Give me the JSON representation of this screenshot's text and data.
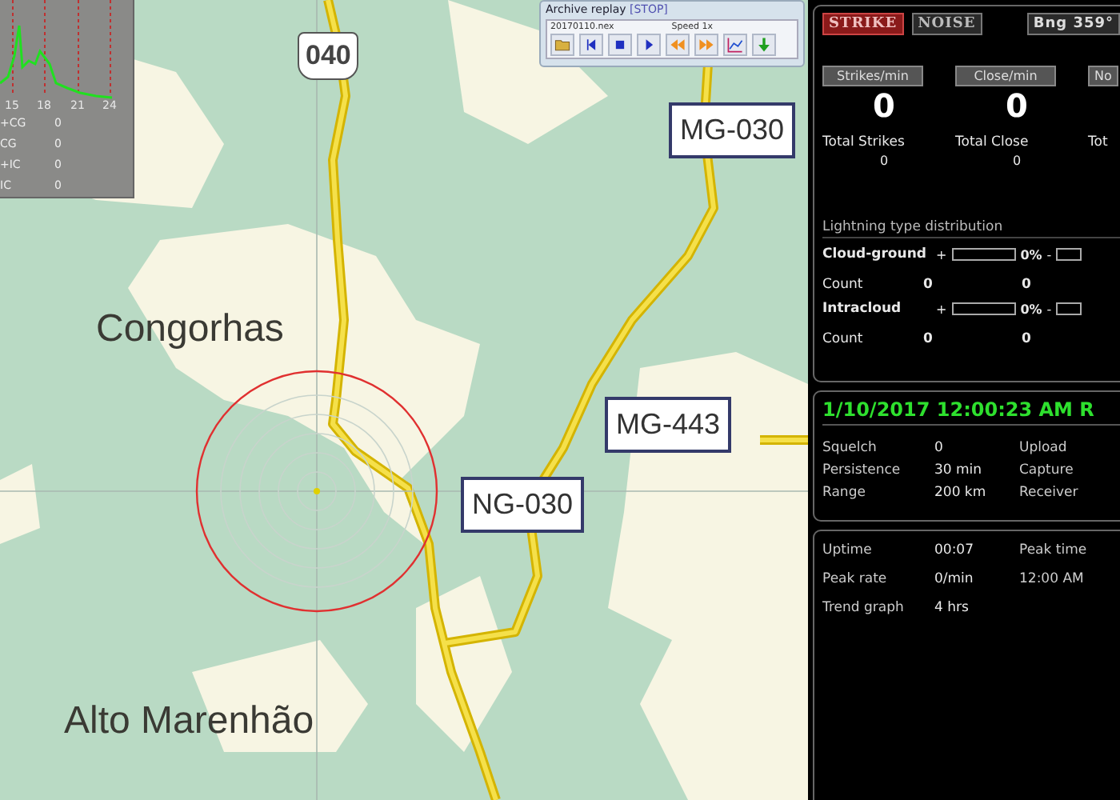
{
  "mini_chart": {
    "x_labels": [
      "15",
      "18",
      "21",
      "24"
    ],
    "rows": [
      {
        "label": "+CG",
        "value": "0"
      },
      {
        "label": "CG",
        "value": "0"
      },
      {
        "label": "+IC",
        "value": "0"
      },
      {
        "label": "IC",
        "value": "0"
      }
    ]
  },
  "replay_window": {
    "title": "Archive replay",
    "state": "[STOP]",
    "file": "20170110.nex",
    "speed": "Speed 1x"
  },
  "map": {
    "labels": [
      {
        "kind": "shield",
        "text": "040"
      },
      {
        "kind": "route",
        "text": "MG-030"
      },
      {
        "kind": "town",
        "text": "Congorhas"
      },
      {
        "kind": "route",
        "text": "MG-443"
      },
      {
        "kind": "route",
        "text": "NG-030"
      },
      {
        "kind": "town",
        "text": "Alto Marenhão"
      }
    ]
  },
  "status": {
    "modes": [
      {
        "label": "STRIKE",
        "selected": true
      },
      {
        "label": "NOISE",
        "selected": false
      }
    ],
    "bearing": "Bng 359°"
  },
  "rates": [
    {
      "button": "Strikes/min",
      "value": "0",
      "total_label": "Total Strikes",
      "total": "0"
    },
    {
      "button": "Close/min",
      "value": "0",
      "total_label": "Total Close",
      "total": "0"
    },
    {
      "button": "No",
      "total_label": "Tot"
    }
  ],
  "distribution": {
    "title": "Lightning type distribution",
    "types": [
      {
        "name": "Cloud-ground",
        "plus": {
          "sign": "+",
          "level": 0
        },
        "percent": "0%",
        "minus": {
          "sign": "-",
          "level": 0
        },
        "count_label": "Count",
        "counts": [
          "0",
          "0"
        ]
      },
      {
        "name": "Intracloud",
        "plus": {
          "sign": "+",
          "level": 0
        },
        "percent": "0%",
        "minus": {
          "sign": "-",
          "level": 0
        },
        "count_label": "Count",
        "counts": [
          "0",
          "0"
        ]
      }
    ]
  },
  "clock": {
    "datetime": "1/10/2017 12:00:23 AM R",
    "rows": [
      [
        "Squelch",
        "0",
        "Upload"
      ],
      [
        "Persistence",
        "30 min",
        "Capture"
      ],
      [
        "Range",
        "200 km",
        "Receiver"
      ]
    ]
  },
  "stats": {
    "rows": [
      [
        "Uptime",
        "00:07",
        "Peak time"
      ],
      [
        "Peak rate",
        "0/min",
        "12:00 AM"
      ],
      [
        "Trend graph",
        "4 hrs"
      ]
    ]
  }
}
